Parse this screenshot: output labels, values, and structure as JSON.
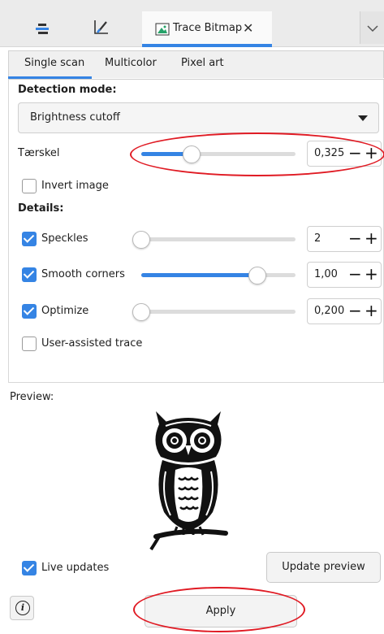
{
  "tabbar": {
    "tab_title": "Trace Bitmap",
    "close_glyph": "✕",
    "menu_glyph": "⌄"
  },
  "subtabs": [
    "Single scan",
    "Multicolor",
    "Pixel art"
  ],
  "detection": {
    "heading": "Detection mode:",
    "mode_value": "Brightness cutoff"
  },
  "threshold": {
    "label": "Tærskel",
    "value": "0,325",
    "level": 0.325
  },
  "invert": {
    "label": "Invert image",
    "checked": false
  },
  "details": {
    "heading": "Details:",
    "speckles": {
      "label": "Speckles",
      "value": "2",
      "checked": true,
      "level": 0.0
    },
    "smooth": {
      "label": "Smooth corners",
      "value": "1,00",
      "checked": true,
      "level": 0.75
    },
    "optimize": {
      "label": "Optimize",
      "value": "0,200",
      "checked": true,
      "level": 0.0
    },
    "user_assisted": {
      "label": "User-assisted trace",
      "checked": false
    }
  },
  "spin_glyphs": {
    "minus": "−",
    "plus": "+"
  },
  "preview": {
    "label": "Preview:"
  },
  "bottom": {
    "live_updates_label": "Live updates",
    "live_updates_checked": true,
    "update_preview_label": "Update preview",
    "apply_label": "Apply",
    "info_glyph": "i"
  },
  "colors": {
    "accent": "#3584e4",
    "annotation": "#e01b24"
  }
}
